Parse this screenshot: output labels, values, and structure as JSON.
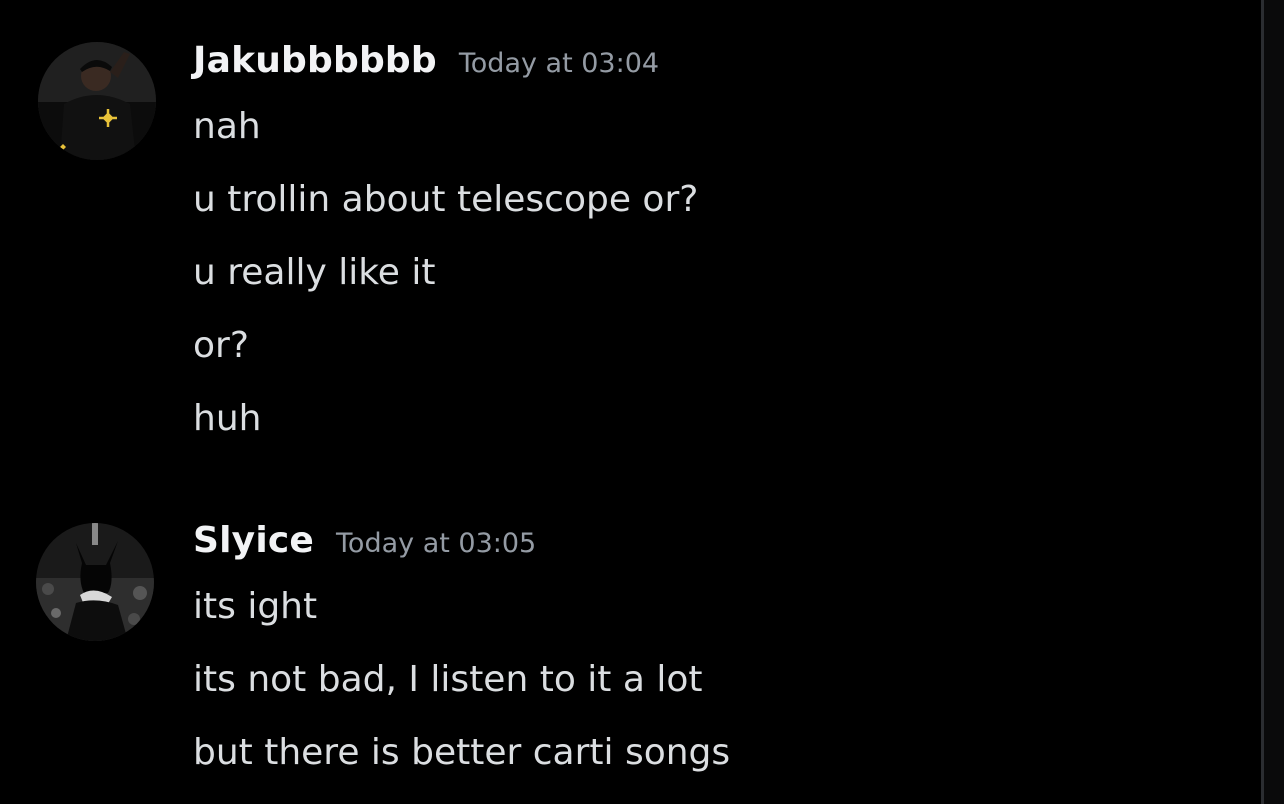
{
  "messages": [
    {
      "username": "Jakubbbbbb",
      "timestamp": "Today at 03:04",
      "avatar_icon": "user-avatar-dark-shirt",
      "lines": [
        "nah",
        "u trollin about telescope or?",
        "u really like it",
        "or?",
        "huh"
      ]
    },
    {
      "username": "Slyice",
      "timestamp": "Today at 03:05",
      "avatar_icon": "user-avatar-concert-photo",
      "lines": [
        "its ight",
        "its not bad, I listen to it a lot",
        "but there is better carti songs"
      ]
    }
  ],
  "colors": {
    "background": "#000000",
    "username": "#f2f3f5",
    "timestamp": "#949ba4",
    "message_text": "#dbdee1"
  }
}
